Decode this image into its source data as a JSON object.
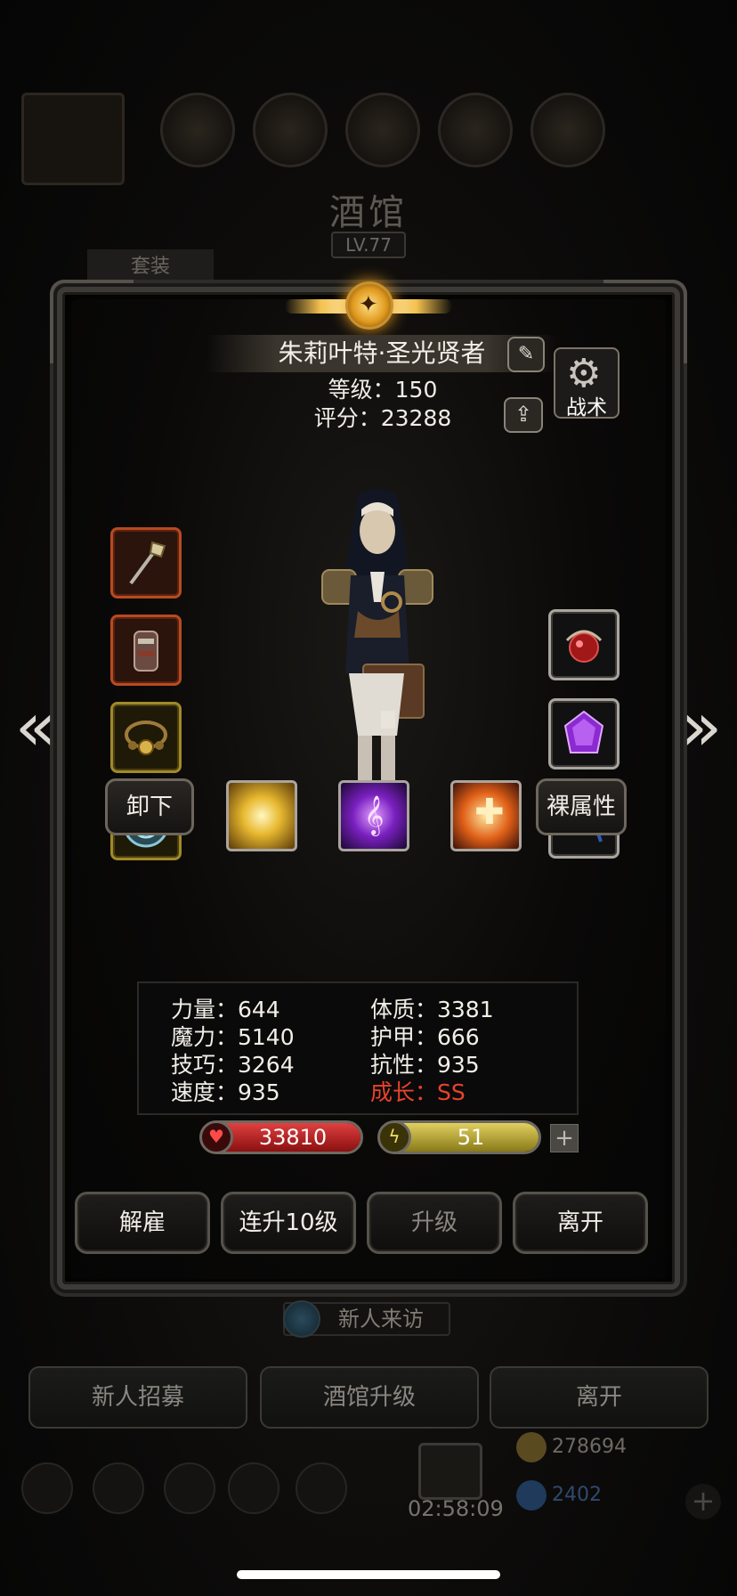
{
  "background": {
    "screen_title": "酒馆",
    "level_badge": "LV.77",
    "tab_label": "套装",
    "visitor_label": "新人来访",
    "buttons": [
      "新人招募",
      "酒馆升级",
      "离开"
    ],
    "timer": "02:58:09",
    "gold": "278694",
    "gems": "2402",
    "plus": "+"
  },
  "hero": {
    "name": "朱莉叶特·圣光贤者",
    "level_text": "等级：150",
    "score_text": "评分：23288",
    "tactics_label": "战术"
  },
  "equipment": {
    "left": [
      {
        "name": "mace-weapon",
        "rarity": "orange"
      },
      {
        "name": "armor-chest",
        "rarity": "orange"
      },
      {
        "name": "bell-necklace",
        "rarity": "gold"
      },
      {
        "name": "round-shield",
        "rarity": "gold"
      }
    ],
    "right": [
      {
        "name": "red-orb-artifact",
        "rarity": "silver"
      },
      {
        "name": "purple-gem",
        "rarity": "silver"
      },
      {
        "name": "blue-ring",
        "rarity": "silver"
      }
    ]
  },
  "skills": {
    "unequip_label": "卸下",
    "base_attributes_label": "裸属性",
    "icons": [
      "holy-light-skill-icon",
      "purple-rune-skill-icon",
      "golden-cross-skill-icon"
    ]
  },
  "stats": {
    "left": [
      "力量：644",
      "魔力：5140",
      "技巧：3264",
      "速度：935"
    ],
    "right": [
      "体质：3381",
      "护甲：666",
      "抗性：935"
    ],
    "growth": "成长：SS"
  },
  "bars": {
    "hp": "33810",
    "hp_fill": 1.0,
    "mp": "51",
    "mp_fill": 1.0,
    "plus": "+"
  },
  "actions": {
    "dismiss": "解雇",
    "level_up_10": "连升10级",
    "level_up": "升级",
    "leave": "离开"
  }
}
